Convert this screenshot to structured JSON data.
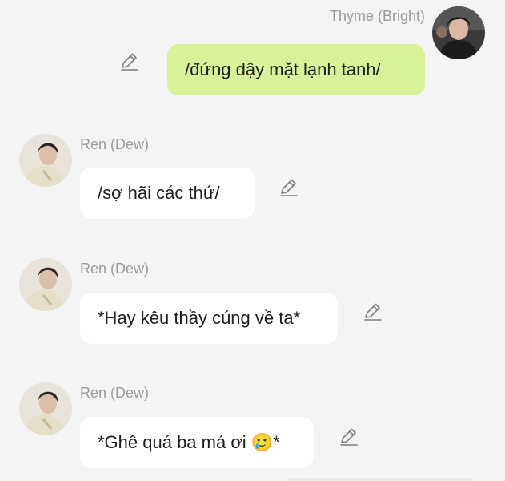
{
  "messages": [
    {
      "sender": "Thyme (Bright)",
      "side": "right",
      "text": "/đứng dậy mặt lạnh tanh/"
    },
    {
      "sender": "Ren (Dew)",
      "side": "left",
      "text": "/sợ hãi các thứ/"
    },
    {
      "sender": "Ren (Dew)",
      "side": "left",
      "text": "*Hay kêu thầy cúng về ta*"
    },
    {
      "sender": "Ren (Dew)",
      "side": "left",
      "text": "*Ghê quá ba má ơi 🥲*"
    }
  ],
  "icons": {
    "edit": "pencil-edit-icon",
    "avatar": "profile-photo"
  },
  "colors": {
    "background": "#f4f4f4",
    "own_bubble": "#d8f29a",
    "other_bubble": "#ffffff",
    "sender_name": "#9a9a9a"
  }
}
